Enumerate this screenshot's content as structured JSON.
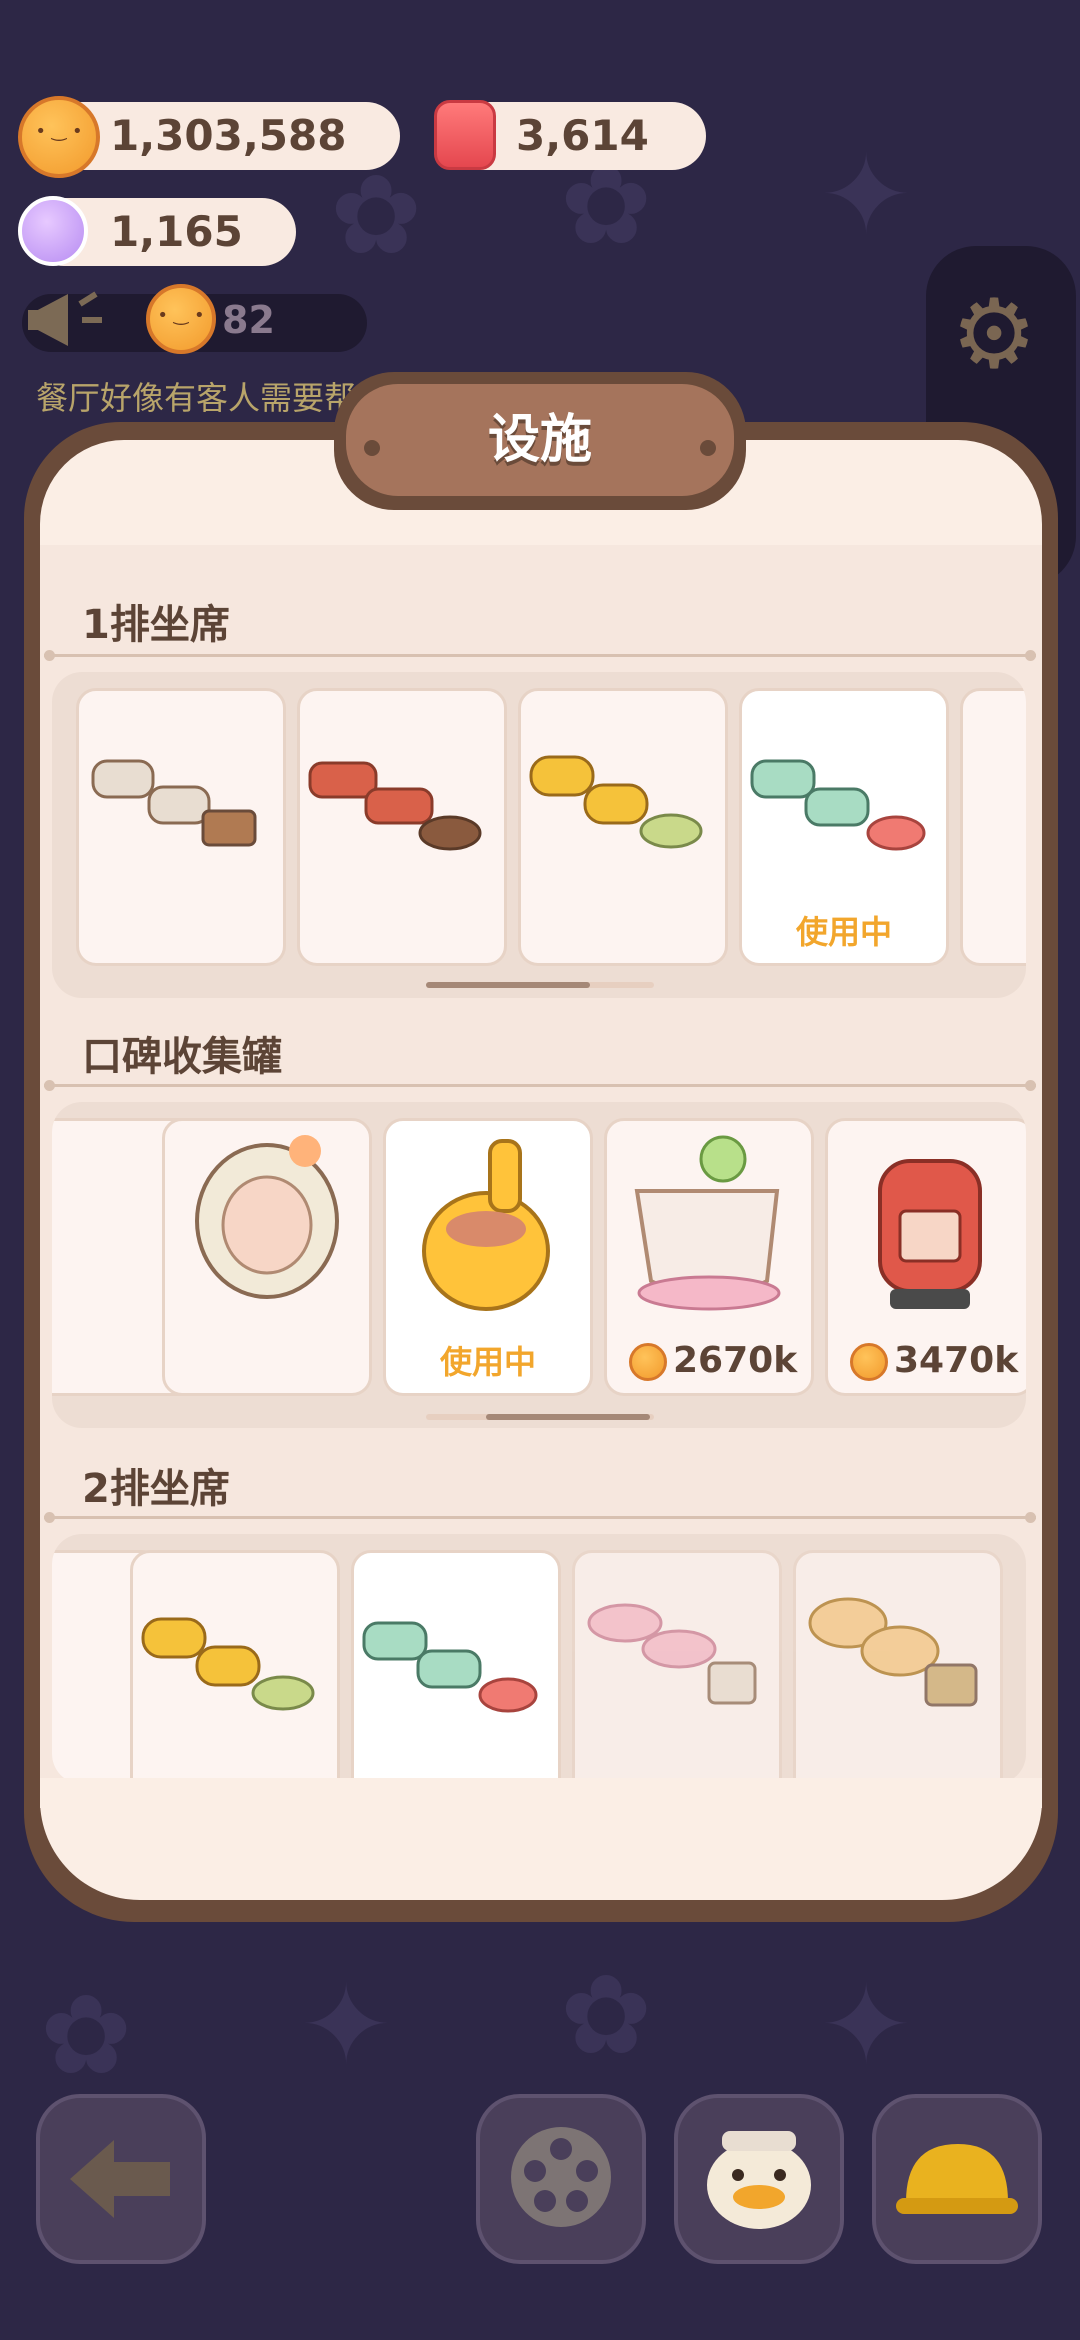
{
  "currencies": {
    "cookies": "1,303,588",
    "candles": "3,614",
    "candy": "1,165"
  },
  "social": {
    "count": "82",
    "notice": "餐厅好像有客人需要帮助"
  },
  "dialog": {
    "title": "设施"
  },
  "sections": [
    {
      "title": "1排坐席",
      "items": [
        {
          "name": "cream-cushion-bench",
          "status": ""
        },
        {
          "name": "red-leather-bench",
          "status": ""
        },
        {
          "name": "yellow-cushion-bench",
          "status": ""
        },
        {
          "name": "green-plaid-bench",
          "status": "使用中"
        }
      ]
    },
    {
      "title": "口碑收集罐",
      "items": [
        {
          "name": "ceramic-vase-jar",
          "status": ""
        },
        {
          "name": "giraffe-jar",
          "status": "使用中"
        },
        {
          "name": "clover-teacup-jar",
          "price": "2670k"
        },
        {
          "name": "postbox-jar",
          "price": "3470k"
        }
      ]
    },
    {
      "title": "2排坐席",
      "items": [
        {
          "name": "yellow-cushion-bench-2"
        },
        {
          "name": "green-plaid-bench-2"
        },
        {
          "name": "pink-stool-bench"
        },
        {
          "name": "melonpan-bench"
        }
      ]
    }
  ],
  "colors": {
    "background": "#2d2746",
    "modal": "#fbeee5",
    "frame": "#6a4b3a",
    "in_use": "#f2a62c"
  },
  "icons": [
    "cookie-coin-icon",
    "candle-icon",
    "candy-icon",
    "megaphone-icon",
    "gear-icon",
    "back-arrow-icon",
    "film-reel-icon",
    "duck-chef-icon",
    "hard-hat-icon"
  ]
}
